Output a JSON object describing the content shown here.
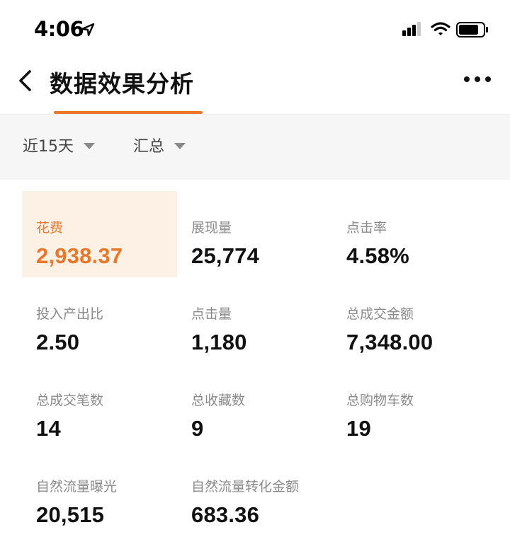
{
  "status_bar": {
    "time": "4:06",
    "icons": [
      "location-arrow-icon",
      "signal-icon",
      "wifi-icon",
      "battery-icon"
    ]
  },
  "header": {
    "title": "数据效果分析",
    "back_icon": "chevron-left-icon",
    "more_icon": "more-dots-icon"
  },
  "filters": {
    "date_range": "近15天",
    "aggregation": "汇总"
  },
  "colors": {
    "accent": "#e8772b",
    "accent_bg": "#fdf1e6",
    "filter_bg": "#f6f6f6"
  },
  "metrics": [
    {
      "label": "花费",
      "value": "2,938.37",
      "selected": true
    },
    {
      "label": "展现量",
      "value": "25,774"
    },
    {
      "label": "点击率",
      "value": "4.58%"
    },
    {
      "label": "投入产出比",
      "value": "2.50"
    },
    {
      "label": "点击量",
      "value": "1,180"
    },
    {
      "label": "总成交金额",
      "value": "7,348.00"
    },
    {
      "label": "总成交笔数",
      "value": "14"
    },
    {
      "label": "总收藏数",
      "value": "9"
    },
    {
      "label": "总购物车数",
      "value": "19"
    },
    {
      "label": "自然流量曝光",
      "value": "20,515"
    },
    {
      "label": "自然流量转化金额",
      "value": "683.36"
    }
  ]
}
